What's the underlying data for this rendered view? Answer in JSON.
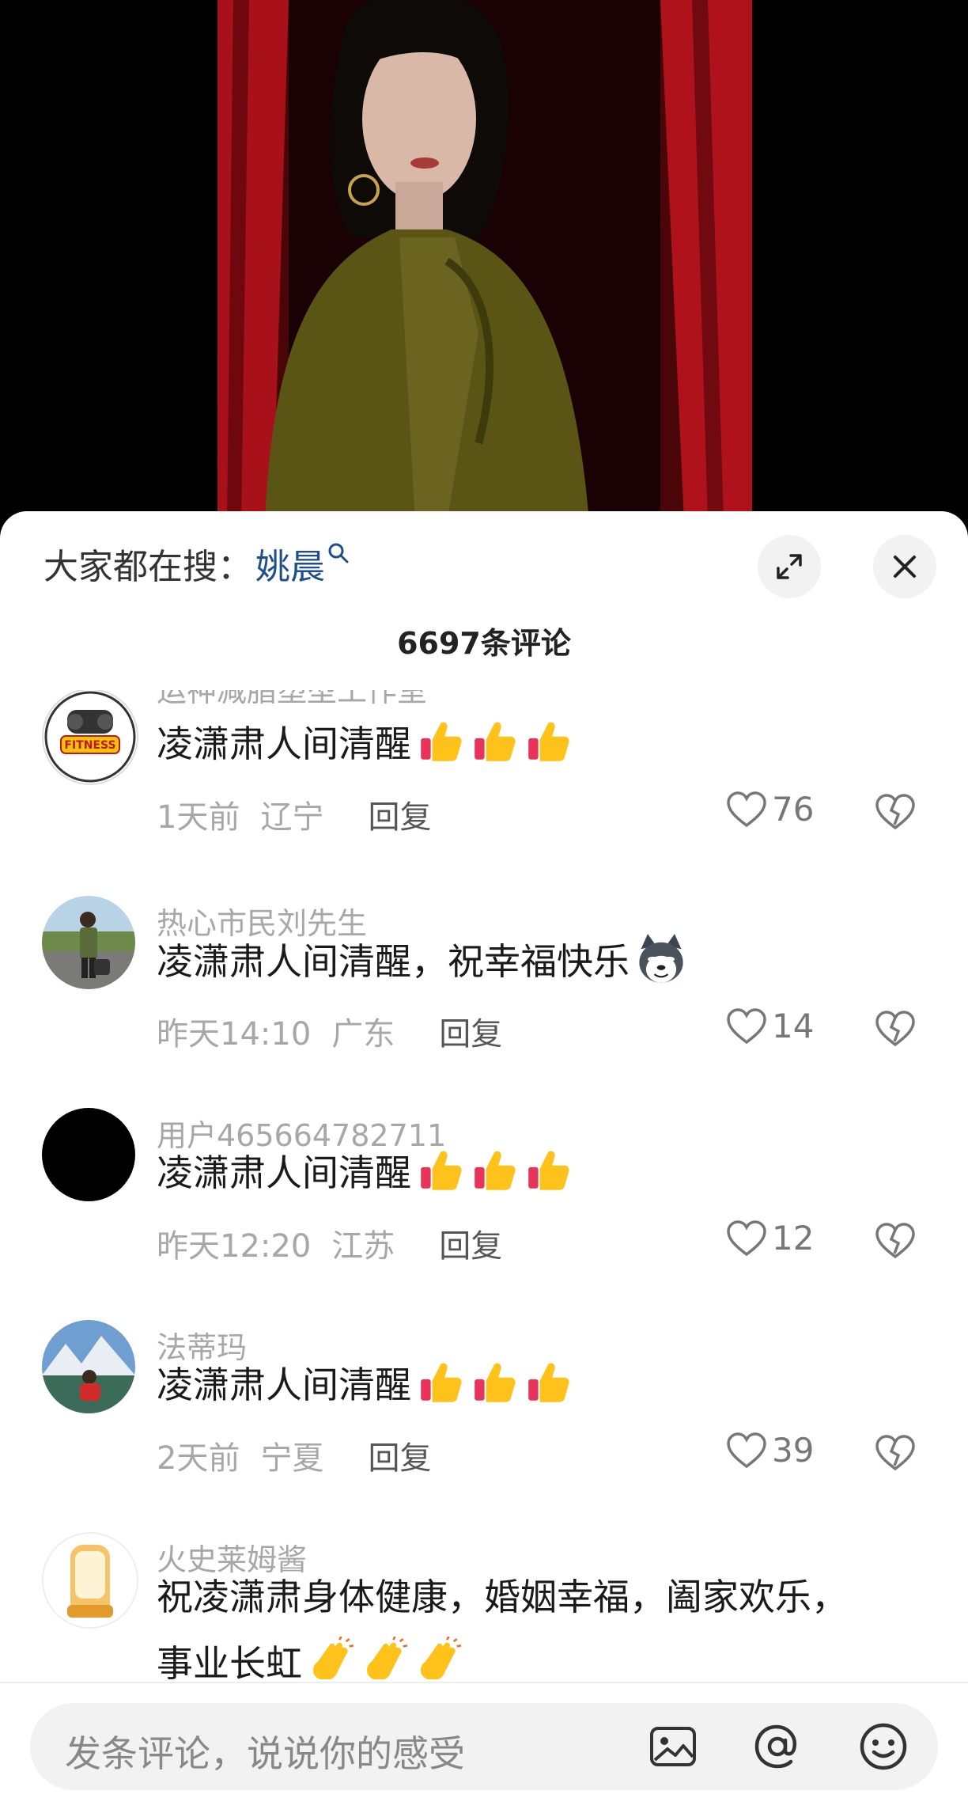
{
  "sheet": {
    "search_prefix": "大家都在搜：",
    "search_term": "姚晨",
    "comment_count": "6697条评论"
  },
  "comments": [
    {
      "author": "运神减脂塑型工作室",
      "text": "凌潇肃人间清醒",
      "emoji": [
        "thumbs-up",
        "thumbs-up",
        "thumbs-up"
      ],
      "time": "1天前",
      "location": "辽宁",
      "reply": "回复",
      "likes": "76"
    },
    {
      "author": "热心市民刘先生",
      "text": "凌潇肃人间清醒，祝幸福快乐",
      "emoji": [
        "husky-face"
      ],
      "time": "昨天14:10",
      "location": "广东",
      "reply": "回复",
      "likes": "14"
    },
    {
      "author": "用户465664782711",
      "text": "凌潇肃人间清醒",
      "emoji": [
        "thumbs-up",
        "thumbs-up",
        "thumbs-up"
      ],
      "time": "昨天12:20",
      "location": "江苏",
      "reply": "回复",
      "likes": "12"
    },
    {
      "author": "法蒂玛",
      "text": "凌潇肃人间清醒",
      "emoji": [
        "thumbs-up",
        "thumbs-up",
        "thumbs-up"
      ],
      "time": "2天前",
      "location": "宁夏",
      "reply": "回复",
      "likes": "39"
    },
    {
      "author": "火史莱姆酱",
      "text": "祝凌潇肃身体健康，婚姻幸福，阖家欢乐，",
      "text2": "事业长虹",
      "emoji": [
        "clapping-hands",
        "clapping-hands",
        "clapping-hands"
      ]
    }
  ],
  "input": {
    "placeholder": "发条评论，说说你的感受"
  },
  "colors": {
    "search_term": "#1f4e8c",
    "meta_gray": "#a7a7a7",
    "sheet_bg": "#ffffff"
  }
}
